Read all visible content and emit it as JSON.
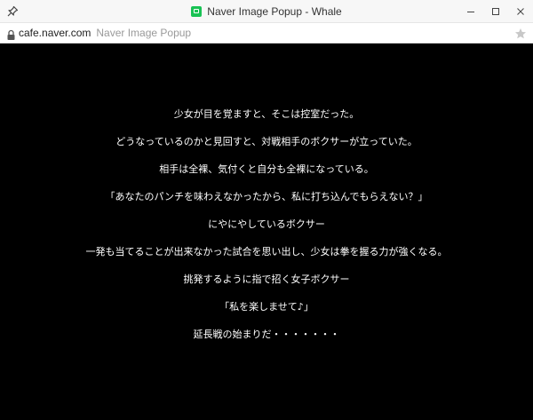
{
  "window": {
    "title": "Naver Image Popup - Whale",
    "controls": {
      "minimize_icon": "minimize-icon",
      "maximize_icon": "maximize-icon",
      "close_icon": "close-icon"
    }
  },
  "address_bar": {
    "host": "cafe.naver.com",
    "page_title": "Naver Image Popup"
  },
  "content": {
    "lines": [
      "少女が目を覚ますと、そこは控室だった。",
      "どうなっているのかと見回すと、対戦相手のボクサーが立っていた。",
      "相手は全裸、気付くと自分も全裸になっている。",
      "「あなたのパンチを味わえなかったから、私に打ち込んでもらえない？」",
      "にやにやしているボクサー",
      "一発も当てることが出来なかった試合を思い出し、少女は拳を握る力が強くなる。",
      "挑発するように指で招く女子ボクサー",
      "「私を楽しませて♪」",
      "延長戦の始まりだ・・・・・・・"
    ]
  },
  "colors": {
    "background": "#000000",
    "text": "#ffffff",
    "app_icon": "#19c254"
  }
}
